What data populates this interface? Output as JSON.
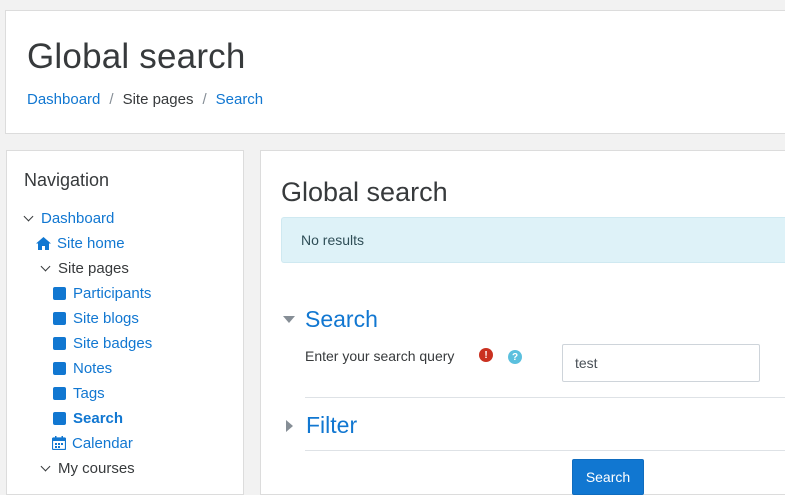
{
  "header": {
    "title": "Global search",
    "breadcrumb": [
      {
        "label": "Dashboard",
        "link": true
      },
      {
        "label": "Site pages",
        "link": false
      },
      {
        "label": "Search",
        "link": true
      }
    ],
    "separator": "/"
  },
  "navigation": {
    "title": "Navigation",
    "items": [
      {
        "label": "Dashboard"
      },
      {
        "label": "Site home"
      },
      {
        "label": "Site pages"
      },
      {
        "label": "Participants"
      },
      {
        "label": "Site blogs"
      },
      {
        "label": "Site badges"
      },
      {
        "label": "Notes"
      },
      {
        "label": "Tags"
      },
      {
        "label": "Search"
      },
      {
        "label": "Calendar"
      },
      {
        "label": "My courses"
      }
    ]
  },
  "main": {
    "title": "Global search",
    "alert": "No results",
    "search_section": "Search",
    "query_label": "Enter your search query",
    "query_value": "test",
    "filter_section": "Filter",
    "submit_label": "Search",
    "required_icon_glyph": "!",
    "help_icon_glyph": "?"
  },
  "colors": {
    "link": "#1177d1",
    "alert_bg": "#def2f8",
    "required": "#ca3120",
    "help": "#5bc0de"
  }
}
